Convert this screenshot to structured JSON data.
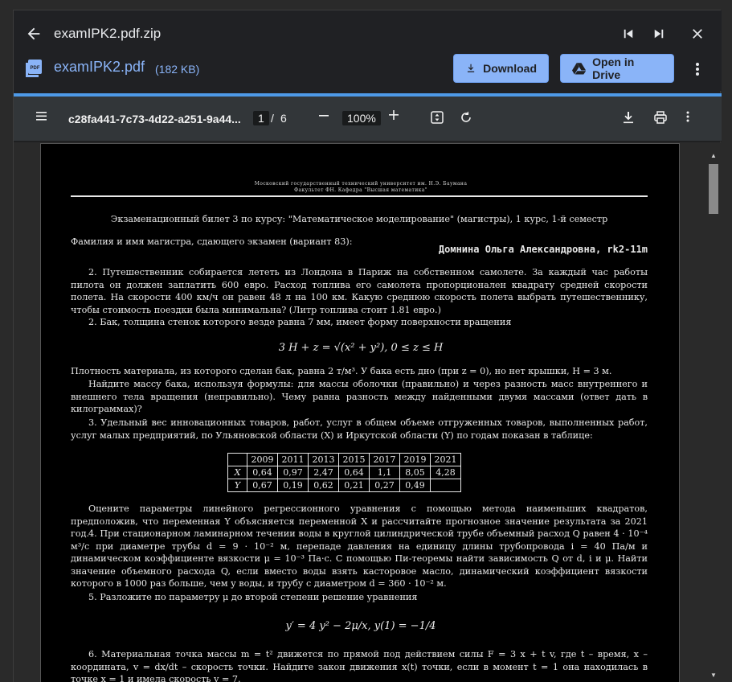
{
  "topbar": {
    "zip_name": "examIPK2.pdf.zip",
    "pdf_name": "examIPK2.pdf",
    "pdf_size": "(182 KB)",
    "download_label": "Download",
    "open_drive_label": "Open in Drive"
  },
  "toolbar": {
    "doc_id": "c28fa441-7c73-4d22-a251-9a44...",
    "page_current": "1",
    "page_sep": "/",
    "page_total": "6",
    "zoom": "100%"
  },
  "doc": {
    "header1": "Московский государственный технический университет им. Н.Э. Баумана",
    "header2": "Факультет ФН. Кафедра \"Высшая математика\"",
    "ticket_title": "Экзаменационный билет 3 по курсу: \"Математическое моделирование\" (магистры), 1 курс, 1-й семестр",
    "student_label": "Фамилия и имя магистра, сдающего экзамен (вариант 83):",
    "student_name": "Домнина Ольга Александровна, rk2-11m",
    "p2a": "2. Путешественник собирается лететь из Лондона в Париж на собственном самолете. За каждый час работы пилота он должен заплатить 600 евро. Расход топлива его самолета пропорционален квадрату средней скорости полета. На скорости 400 км/ч он равен 48 л на 100 км. Какую среднюю скорость полета выбрать путешественнику, чтобы стоимость поездки была минимальна? (Литр топлива стоит 1.81 евро.)",
    "p2b": "2. Бак, толщина стенок которого везде равна 7 мм, имеет форму поверхности вращения",
    "formula1": "3 H + z = √(x² + y²), 0 ≤ z ≤ H",
    "p2c": "Плотность материала, из которого сделан бак, равна 2 т/м³. У бака есть дно (при z = 0), но нет крышки, H = 3 м.",
    "p2d": "Найдите массу бака, используя формулы: для массы оболочки (правильно) и через разность масс внутреннего и внешнего тела вращения (неправильно). Чему равна разность между найденными двумя массами (ответ дать в килограммах)?",
    "p3": "3. Удельный вес инновационных товаров, работ, услуг в общем объеме отгруженных товаров, выполненных работ, услуг малых предприятий, по Ульяновской области (X) и Иркутской области (Y) по годам показан в таблице:",
    "table": {
      "years": [
        "2009",
        "2011",
        "2013",
        "2015",
        "2017",
        "2019",
        "2021"
      ],
      "x_label": "X",
      "y_label": "Y",
      "x": [
        "0,64",
        "0,97",
        "2,47",
        "0,64",
        "1,1",
        "8,05",
        "4,28"
      ],
      "y": [
        "0,67",
        "0,19",
        "0,62",
        "0,21",
        "0,27",
        "0,49",
        ""
      ]
    },
    "p3b": "Оцените параметры линейного регрессионного уравнения с помощью метода наименьших квадратов, предположив, что переменная Y объясняется переменной X и рассчитайте прогнозное значение результата за 2021 год.",
    "p4": "4. При стационарном ламинарном течении воды в круглой цилиндрической трубе объемный расход Q равен 4 · 10⁻⁴ м³/с при диаметре трубы d = 9 · 10⁻² м, перепаде давления на единицу длины трубопровода i = 40 Па/м и динамическом коэффициенте вязкости μ = 10⁻³ Па·с. С помощью Пи-теоремы найти зависимость Q от d, i и μ. Найти значение объемного расхода Q, если вместо воды взять касторовое масло, динамический коэффициент вязкости которого в 1000 раз больше, чем у воды, и трубу с диаметром d = 360 · 10⁻² м.",
    "p5": "5. Разложите по параметру μ до второй степени решение уравнения",
    "formula2": "y′ = 4 y² − 2μ/x, y(1) = −1/4",
    "p6": "6. Материальная точка массы m = t² движется по прямой под действием силы F = 3 x + t v, где t – время, x – координата, v = dx/dt – скорость точки. Найдите закон движения x(t) точки, если в момент t = 1 она находилась в точке x = 1 и имела скорость v = 7."
  }
}
